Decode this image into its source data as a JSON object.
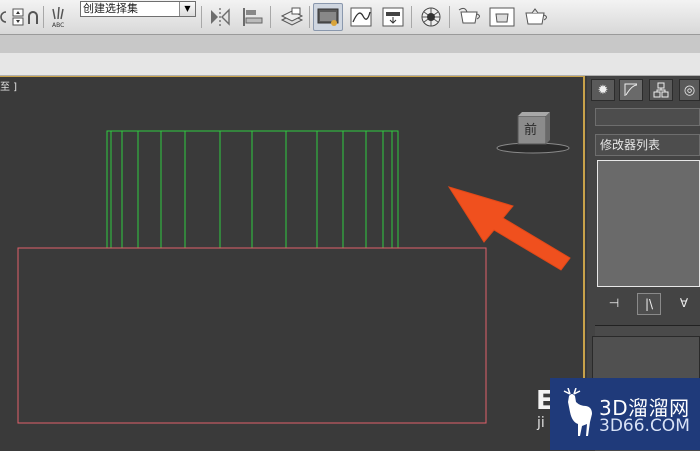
{
  "toolbar": {
    "selection_set": {
      "value": "创建选择集",
      "placeholder": "创建选择集"
    },
    "icons": [
      "spinner-snap-icon",
      "percent-snap-icon",
      "edit-named-selection-icon",
      "mirror-icon",
      "align-icon",
      "layer-manager-icon",
      "scene-explorer-icon",
      "curve-editor-icon",
      "schematic-view-icon",
      "material-editor-icon",
      "render-setup-icon",
      "rendered-frame-window-icon",
      "render-icon"
    ]
  },
  "viewport": {
    "label": "至 ]",
    "viewcube_label": "前",
    "objects": [
      {
        "name": "green-box",
        "color": "#2ecc40"
      },
      {
        "name": "red-plane",
        "color": "#e0606a"
      }
    ],
    "annotation_color": "#f0501e"
  },
  "command_panel": {
    "tabs": [
      "create-tab-icon",
      "modify-tab-icon",
      "hierarchy-tab-icon",
      "motion-tab-icon"
    ],
    "object_name": "",
    "modifier_list_label": "修改器列表",
    "stack_tools": [
      "pin-stack-icon",
      "show-end-result-icon",
      "make-unique-icon"
    ]
  },
  "watermark": {
    "brand": "3D溜溜网",
    "url": "3D66.COM",
    "partial_left_1": "E",
    "partial_left_2": "ji"
  }
}
